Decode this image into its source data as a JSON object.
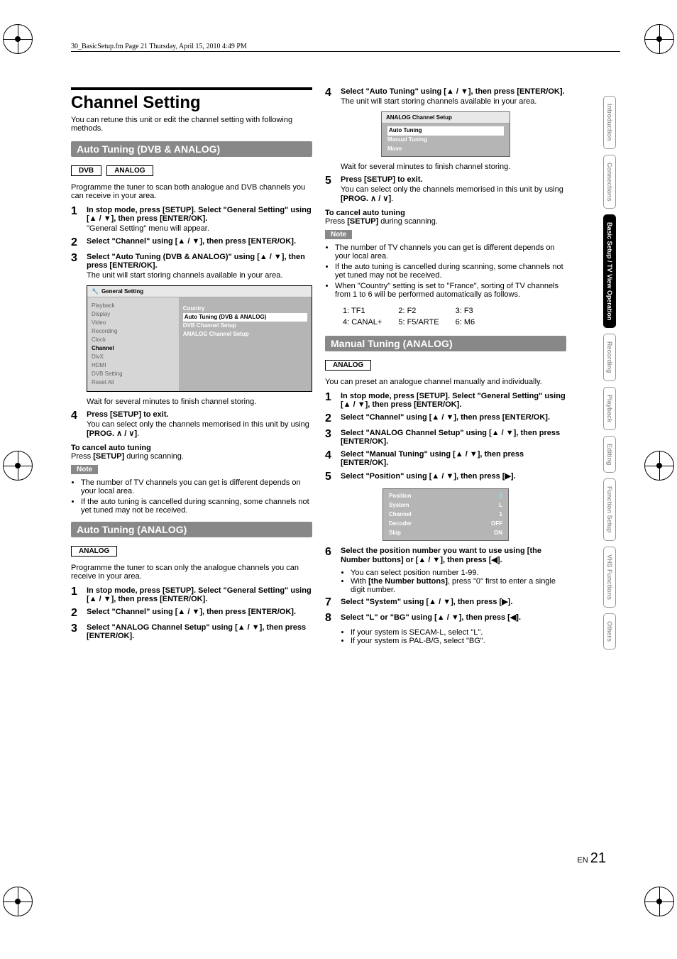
{
  "header": "30_BasicSetup.fm  Page 21  Thursday, April 15, 2010  4:49 PM",
  "side_tabs": [
    "Introduction",
    "Connections",
    "Basic Setup / TV View Operation",
    "Recording",
    "Playback",
    "Editing",
    "Function Setup",
    "VHS Functions",
    "Others"
  ],
  "title": "Channel Setting",
  "subtitle": "You can retune this unit or edit the channel setting with following methods.",
  "section1": {
    "header": "Auto Tuning (DVB & ANALOG)",
    "tags": [
      "DVB",
      "ANALOG"
    ],
    "intro": "Programme the tuner to scan both analogue and DVB channels you can receive in your area.",
    "steps": [
      {
        "title": "In stop mode, press [SETUP]. Select \"General Setting\" using [▲ / ▼], then press [ENTER/OK].",
        "sub": "\"General Setting\" menu will appear."
      },
      {
        "title": "Select \"Channel\" using [▲ / ▼], then press [ENTER/OK].",
        "sub": ""
      },
      {
        "title": "Select \"Auto Tuning (DVB & ANALOG)\" using [▲ / ▼], then press [ENTER/OK].",
        "sub": "The unit will start storing channels available in your area."
      }
    ],
    "osd": {
      "title": "General Setting",
      "left": [
        "Playback",
        "Display",
        "Video",
        "Recording",
        "Clock",
        "Channel",
        "DivX",
        "HDMI",
        "DVB Setting",
        "Reset All"
      ],
      "left_selected": "Channel",
      "right_label": "Country",
      "right_items": [
        "Auto Tuning (DVB & ANALOG)",
        "DVB Channel Setup",
        "ANALOG Channel Setup"
      ],
      "right_hl": "Auto Tuning (DVB & ANALOG)"
    },
    "wait": "Wait for several minutes to finish channel storing.",
    "step4": {
      "title": "Press [SETUP] to exit.",
      "sub": "You can select only the channels memorised in this unit by using ",
      "sub_bold": "[PROG. ∧ / ∨]"
    },
    "cancel_h": "To cancel auto tuning",
    "cancel_t1": "Press ",
    "cancel_b": "[SETUP]",
    "cancel_t2": " during scanning.",
    "note": "Note",
    "notes": [
      "The number of TV channels you can get is different depends on your local area.",
      "If the auto tuning is cancelled during scanning, some channels not yet tuned may not be received."
    ]
  },
  "section2": {
    "header": "Auto Tuning (ANALOG)",
    "tags": [
      "ANALOG"
    ],
    "intro": "Programme the tuner to scan only the analogue channels you can receive in your area.",
    "steps": [
      {
        "title": "In stop mode, press [SETUP]. Select \"General Setting\" using [▲ / ▼], then press [ENTER/OK].",
        "sub": ""
      },
      {
        "title": "Select \"Channel\" using [▲ / ▼], then press [ENTER/OK].",
        "sub": ""
      },
      {
        "title": "Select \"ANALOG Channel Setup\" using [▲ / ▼], then press [ENTER/OK].",
        "sub": ""
      }
    ]
  },
  "section2b": {
    "step4": {
      "title": "Select \"Auto Tuning\" using [▲ / ▼], then press [ENTER/OK].",
      "sub": "The unit will start storing channels available in your area."
    },
    "osd": {
      "title": "ANALOG Channel Setup",
      "items": [
        "Auto Tuning",
        "Manual Tuning",
        "Move"
      ],
      "hl": "Auto Tuning"
    },
    "wait": "Wait for several minutes to finish channel storing.",
    "step5": {
      "title": "Press [SETUP] to exit.",
      "sub": "You can select only the channels memorised in this unit by using ",
      "sub_bold": "[PROG. ∧ / ∨]"
    },
    "cancel_h": "To cancel auto tuning",
    "cancel_t1": "Press ",
    "cancel_b": "[SETUP]",
    "cancel_t2": " during scanning.",
    "note": "Note",
    "notes": [
      "The number of TV channels you can get is different depends on your local area.",
      "If the auto tuning is cancelled during scanning, some channels not yet tuned may not be received.",
      "When \"Country\" setting is set to \"France\", sorting of TV channels from 1 to 6 will be performed automatically as follows."
    ],
    "channels": [
      [
        "1: TF1",
        "2: F2",
        "3: F3"
      ],
      [
        "4: CANAL+",
        "5: F5/ARTE",
        "6: M6"
      ]
    ]
  },
  "section3": {
    "header": "Manual Tuning (ANALOG)",
    "tags": [
      "ANALOG"
    ],
    "intro": "You can preset an analogue channel manually and individually.",
    "steps": [
      {
        "title": "In stop mode, press [SETUP]. Select \"General Setting\" using [▲ / ▼], then press [ENTER/OK]."
      },
      {
        "title": "Select \"Channel\" using [▲ / ▼], then press [ENTER/OK]."
      },
      {
        "title": "Select \"ANALOG Channel Setup\" using [▲ / ▼], then press [ENTER/OK]."
      },
      {
        "title": "Select \"Manual Tuning\" using [▲ / ▼], then press [ENTER/OK]."
      },
      {
        "title": "Select \"Position\" using [▲ / ▼], then press [▶]."
      }
    ],
    "osd": [
      {
        "k": "Position",
        "v": "1",
        "hl": true
      },
      {
        "k": "System",
        "v": "L"
      },
      {
        "k": "Channel",
        "v": "1"
      },
      {
        "k": "Decoder",
        "v": "OFF"
      },
      {
        "k": "Skip",
        "v": "ON"
      }
    ],
    "step6": {
      "title": "Select the position number you want to use using [the Number buttons] or [▲ / ▼], then press [◀]."
    },
    "step6_subs": [
      "You can select position number 1-99.",
      "With [the Number buttons], press \"0\" first to enter a single digit number."
    ],
    "step7": {
      "title": "Select \"System\" using [▲ / ▼], then press [▶]."
    },
    "step8": {
      "title": "Select \"L\" or \"BG\" using [▲ / ▼], then press [◀]."
    },
    "step8_subs": [
      "If your system is SECAM-L, select \"L\".",
      "If your system is PAL-B/G, select \"BG\"."
    ]
  },
  "page_num_prefix": "EN",
  "page_num": "21"
}
